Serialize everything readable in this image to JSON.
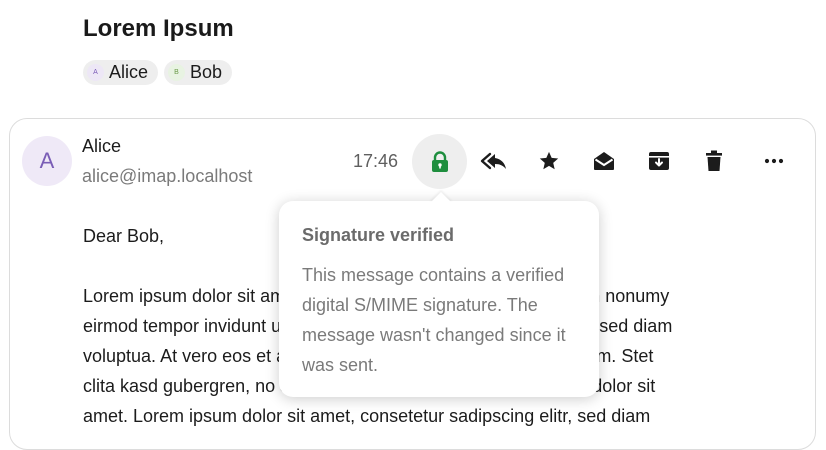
{
  "thread": {
    "subject": "Lorem Ipsum",
    "participants": [
      {
        "initial": "A",
        "name": "Alice"
      },
      {
        "initial": "B",
        "name": "Bob"
      }
    ]
  },
  "message": {
    "sender_initial": "A",
    "sender_name": "Alice",
    "sender_email": "alice@imap.localhost",
    "time": "17:46",
    "greeting": "Dear Bob,",
    "body_lines": [
      "Lorem ipsum dolor sit amet, consetetur sadipscing elitr, sed diam nonumy",
      "eirmod tempor invidunt ut labore et dolore magna aliquyam erat, sed diam",
      "voluptua. At vero eos et accusam et justo duo dolores et ea rebum. Stet",
      "clita kasd gubergren, no sea takimata sanctus est Lorem ipsum dolor sit",
      "amet. Lorem ipsum dolor sit amet, consetetur sadipscing elitr, sed diam"
    ]
  },
  "toolbar": {
    "icons": [
      "lock-icon",
      "reply-all-icon",
      "star-icon",
      "mark-read-icon",
      "archive-icon",
      "trash-icon",
      "more-icon"
    ],
    "lock_color": "#1e8e3e"
  },
  "signature_popover": {
    "title": "Signature verified",
    "text": "This message contains a verified digital S/MIME signature. The message wasn't changed since it was sent."
  }
}
